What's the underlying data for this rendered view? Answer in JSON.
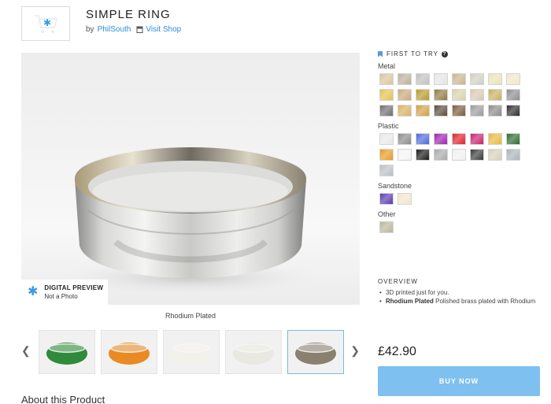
{
  "header": {
    "title": "SIMPLE RING",
    "by": "by",
    "author": "PhilSouth",
    "visit_shop": "Visit Shop"
  },
  "preview": {
    "badge_title": "DIGITAL PREVIEW",
    "badge_sub": "Not a Photo",
    "caption": "Rhodium Plated"
  },
  "thumbnails": [
    {
      "color": "#2f8a3a",
      "label": "green"
    },
    {
      "color": "#e98a24",
      "label": "orange"
    },
    {
      "color": "#f2f1ea",
      "label": "white"
    },
    {
      "color": "#e9e9e2",
      "label": "frosted"
    },
    {
      "color": "#8a8070",
      "label": "camo",
      "selected": true
    }
  ],
  "about_heading": "About this Product",
  "sidebar": {
    "first_try": "FIRST TO TRY",
    "groups": [
      {
        "label": "Metal",
        "swatches": [
          "#d9c49a",
          "#b9b09c",
          "#bfbfbf",
          "#e4e4e4",
          "#c9b48a",
          "#cfcfc0",
          "#e7e3b8",
          "#f0e7c8",
          "#e3c14e",
          "#c9a87a",
          "#b89a2a",
          "#8f7a42",
          "#d8d2a8",
          "#d8c8b0",
          "#c8b060",
          "#8b8d91",
          "#6e6e6e",
          "#d8b060",
          "#d0a040",
          "#5a4a3a",
          "#7a5a3a",
          "#9a9a9a",
          "#8a8a8a",
          "#2d2d2d"
        ]
      },
      {
        "label": "Plastic",
        "swatches": [
          "#e8e8e8",
          "#8a8a8a",
          "#4a6ad8",
          "#a020b0",
          "#e0202a",
          "#c82070",
          "#e8b83a",
          "#2f6a32",
          "#e89a20",
          "#f4f4f4",
          "#1a1a1a",
          "#a8a8a8",
          "#f0f0f0",
          "#3a3a3a",
          "#d8cfb8",
          "#a8b4bc",
          "#b8c0c6"
        ]
      },
      {
        "label": "Sandstone",
        "swatches": [
          "#5a3ab0",
          "#f4e4cc"
        ]
      },
      {
        "label": "Other",
        "swatches": [
          "#b8b69a"
        ]
      }
    ]
  },
  "overview": {
    "heading": "OVERVIEW",
    "item1": "3D printed just for you.",
    "item2_bold": "Rhodium Plated",
    "item2_rest": " Polished brass plated with Rhodium"
  },
  "price": "£42.90",
  "buy_label": "BUY NOW"
}
